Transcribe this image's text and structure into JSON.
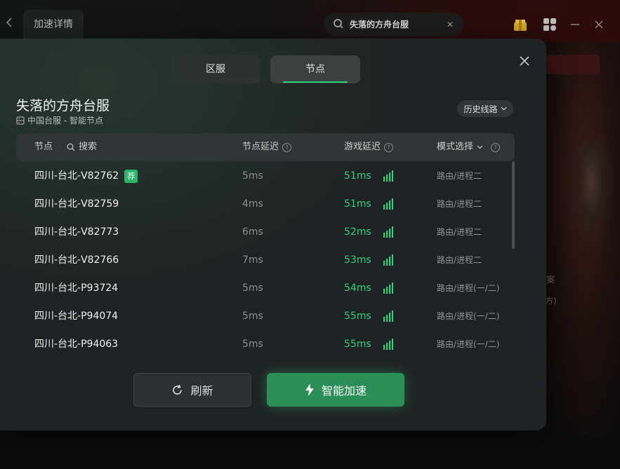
{
  "topbar": {
    "back_icon": "chevron-left-icon",
    "tab_label": "加速详情",
    "search_value": "失落的方舟台服",
    "icons": [
      "gift-icon",
      "apps-grid-icon",
      "minimize-icon",
      "close-icon"
    ]
  },
  "background": {
    "partial_text_1": "案",
    "partial_text_2": "方)"
  },
  "modal": {
    "tabs": [
      {
        "label": "区服",
        "selected": false
      },
      {
        "label": "节点",
        "selected": true
      }
    ],
    "game_title": "失落的方舟台服",
    "subtitle": "中国台服 - 智能节点",
    "history_label": "历史线路",
    "table": {
      "col_node": "节点",
      "search_label": "搜索",
      "col_node_latency": "节点延迟",
      "col_game_latency": "游戏延迟",
      "col_mode": "模式选择",
      "rows": [
        {
          "name": "四川-台北-V82762",
          "badge": "荐",
          "node_latency": "5ms",
          "game_latency": "51ms",
          "mode": "路由/进程二"
        },
        {
          "name": "四川-台北-V82759",
          "badge": "",
          "node_latency": "4ms",
          "game_latency": "51ms",
          "mode": "路由/进程二"
        },
        {
          "name": "四川-台北-V82773",
          "badge": "",
          "node_latency": "6ms",
          "game_latency": "52ms",
          "mode": "路由/进程二"
        },
        {
          "name": "四川-台北-V82766",
          "badge": "",
          "node_latency": "7ms",
          "game_latency": "53ms",
          "mode": "路由/进程二"
        },
        {
          "name": "四川-台北-P93724",
          "badge": "",
          "node_latency": "5ms",
          "game_latency": "54ms",
          "mode": "路由/进程(一/二)"
        },
        {
          "name": "四川-台北-P94074",
          "badge": "",
          "node_latency": "5ms",
          "game_latency": "55ms",
          "mode": "路由/进程(一/二)"
        },
        {
          "name": "四川-台北-P94063",
          "badge": "",
          "node_latency": "5ms",
          "game_latency": "55ms",
          "mode": "路由/进程(一/二)"
        }
      ]
    },
    "refresh_label": "刷新",
    "boost_label": "智能加速"
  },
  "colors": {
    "accent_green": "#2ed37c",
    "button_green": "#2a8f57",
    "modal_bg": "#1f2224"
  }
}
